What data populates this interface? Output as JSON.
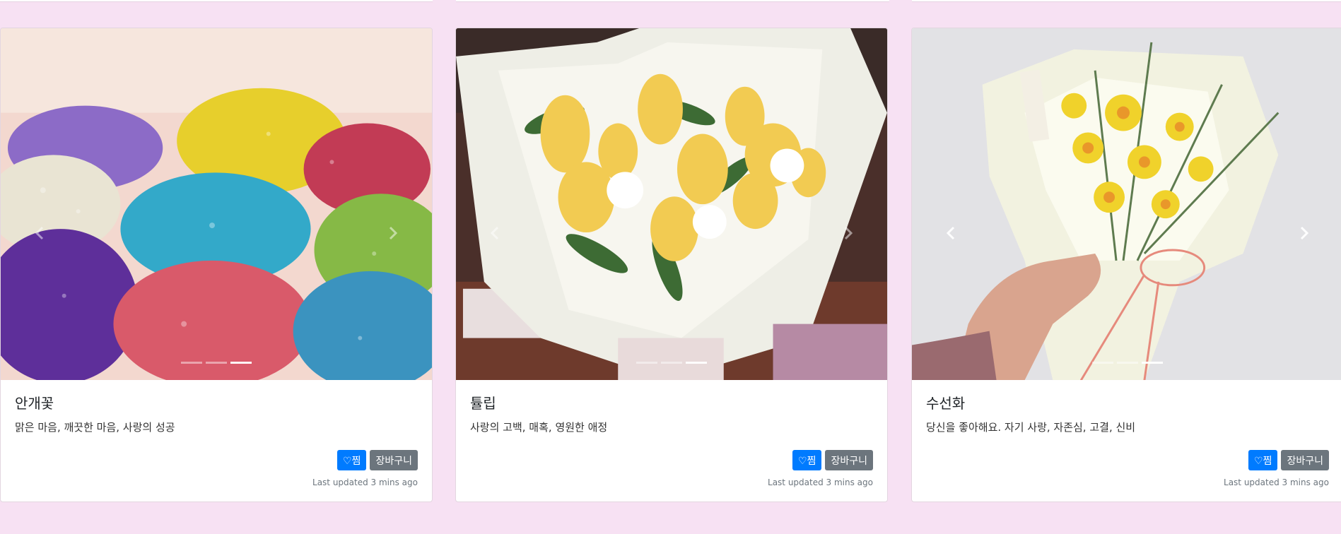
{
  "colors": {
    "page_background": "#f7e1f3",
    "like_button": "#007bff",
    "cart_button": "#6c757d",
    "muted_text": "#6c757d"
  },
  "icons": {
    "prev": "chevron-left-icon",
    "next": "chevron-right-icon",
    "heart": "heart-icon"
  },
  "cards": [
    {
      "title": "안개꽃",
      "description": "맑은 마음, 깨끗한 마음, 사랑의 성공",
      "like_label": "♡찜",
      "cart_label": "장바구니",
      "updated": "Last updated 3 mins ago",
      "slide_count": 3,
      "active_slide": 3
    },
    {
      "title": "튤립",
      "description": "사랑의 고백, 매혹, 영원한 애정",
      "like_label": "♡찜",
      "cart_label": "장바구니",
      "updated": "Last updated 3 mins ago",
      "slide_count": 3,
      "active_slide": 3
    },
    {
      "title": "수선화",
      "description": "당신을 좋아해요. 자기 사랑, 자존심, 고결, 신비",
      "like_label": "♡찜",
      "cart_label": "장바구니",
      "updated": "Last updated 3 mins ago",
      "slide_count": 3,
      "active_slide": 3
    }
  ]
}
